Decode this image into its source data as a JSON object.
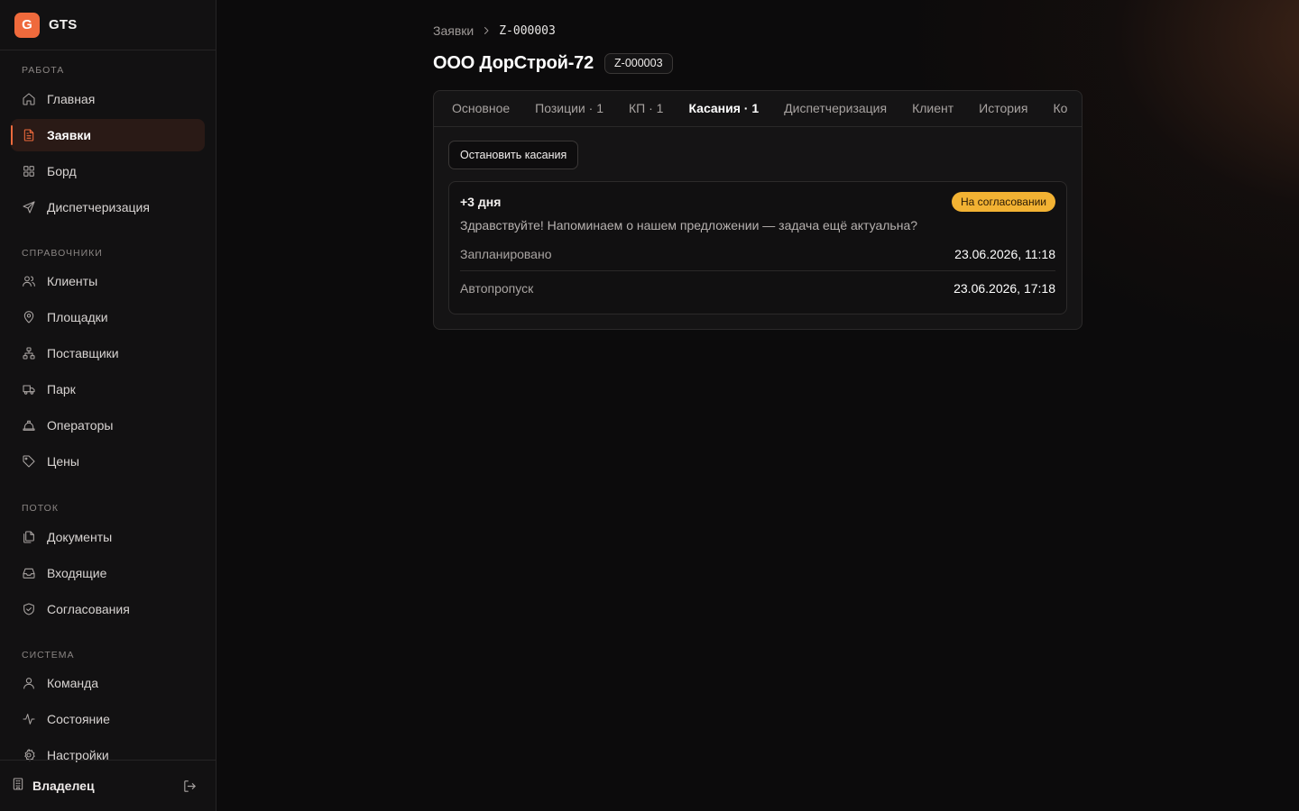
{
  "app": {
    "logo_letter": "G",
    "name": "GTS"
  },
  "sidebar": {
    "sections": [
      {
        "label": "РАБОТА",
        "items": [
          {
            "label": "Главная",
            "icon": "home-icon"
          },
          {
            "label": "Заявки",
            "icon": "file-text-icon",
            "active": true
          },
          {
            "label": "Борд",
            "icon": "grid-icon"
          },
          {
            "label": "Диспетчеризация",
            "icon": "send-icon"
          }
        ]
      },
      {
        "label": "СПРАВОЧНИКИ",
        "items": [
          {
            "label": "Клиенты",
            "icon": "users-icon"
          },
          {
            "label": "Площадки",
            "icon": "map-pin-icon"
          },
          {
            "label": "Поставщики",
            "icon": "network-icon"
          },
          {
            "label": "Парк",
            "icon": "truck-icon"
          },
          {
            "label": "Операторы",
            "icon": "hard-hat-icon"
          },
          {
            "label": "Цены",
            "icon": "tag-icon"
          }
        ]
      },
      {
        "label": "ПОТОК",
        "items": [
          {
            "label": "Документы",
            "icon": "files-icon"
          },
          {
            "label": "Входящие",
            "icon": "inbox-icon"
          },
          {
            "label": "Согласования",
            "icon": "shield-check-icon"
          }
        ]
      },
      {
        "label": "СИСТЕМА",
        "items": [
          {
            "label": "Команда",
            "icon": "user-icon"
          },
          {
            "label": "Состояние",
            "icon": "activity-icon"
          },
          {
            "label": "Настройки",
            "icon": "settings-icon"
          }
        ]
      }
    ],
    "footer": {
      "role": "Владелец",
      "icon": "building-icon",
      "logout_icon": "log-out-icon"
    }
  },
  "breadcrumb": {
    "parent": "Заявки",
    "current": "Z-000003"
  },
  "header": {
    "title": "ООО ДорСтрой-72",
    "id_badge": "Z-000003"
  },
  "tabs": [
    {
      "label": "Основное"
    },
    {
      "label": "Позиции · 1"
    },
    {
      "label": "КП · 1"
    },
    {
      "label": "Касания · 1",
      "active": true
    },
    {
      "label": "Диспетчеризация"
    },
    {
      "label": "Клиент"
    },
    {
      "label": "История"
    },
    {
      "label": "Ко"
    }
  ],
  "touches": {
    "stop_button": "Остановить касания",
    "items": [
      {
        "offset": "+3 дня",
        "status": "На согласовании",
        "status_color": "#f2b233",
        "message": "Здравствуйте! Напоминаем о нашем предложении — задача ещё актуальна?",
        "scheduled_label": "Запланировано",
        "scheduled_value": "23.06.2026, 11:18",
        "autoskip_label": "Автопропуск",
        "autoskip_value": "23.06.2026, 17:18"
      }
    ]
  },
  "colors": {
    "accent": "#ef6a3c",
    "background": "#0c0b0c",
    "sidebar": "#121112"
  }
}
